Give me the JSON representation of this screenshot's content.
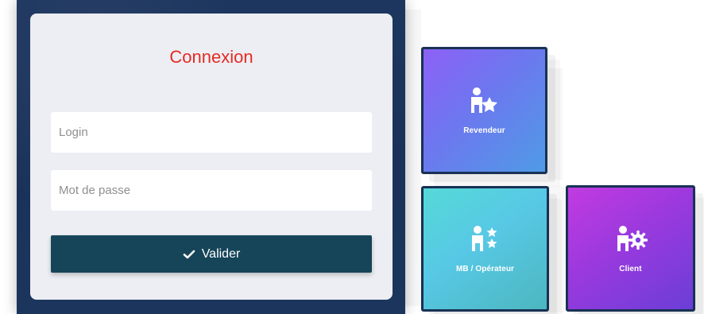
{
  "login": {
    "title": "Connexion",
    "login_placeholder": "Login",
    "password_placeholder": "Mot de passe",
    "submit_label": "Valider",
    "submit_icon": "check-icon",
    "colors": {
      "title": "#e52b24",
      "panel_background": "#1b345a",
      "card_background": "#eceef3",
      "button_background": "#164559"
    }
  },
  "tiles": [
    {
      "label": "Revendeur",
      "icon": "reseller-icon"
    },
    {
      "label": "MB / Opérateur",
      "icon": "operator-icon"
    },
    {
      "label": "Client",
      "icon": "client-settings-icon"
    }
  ]
}
